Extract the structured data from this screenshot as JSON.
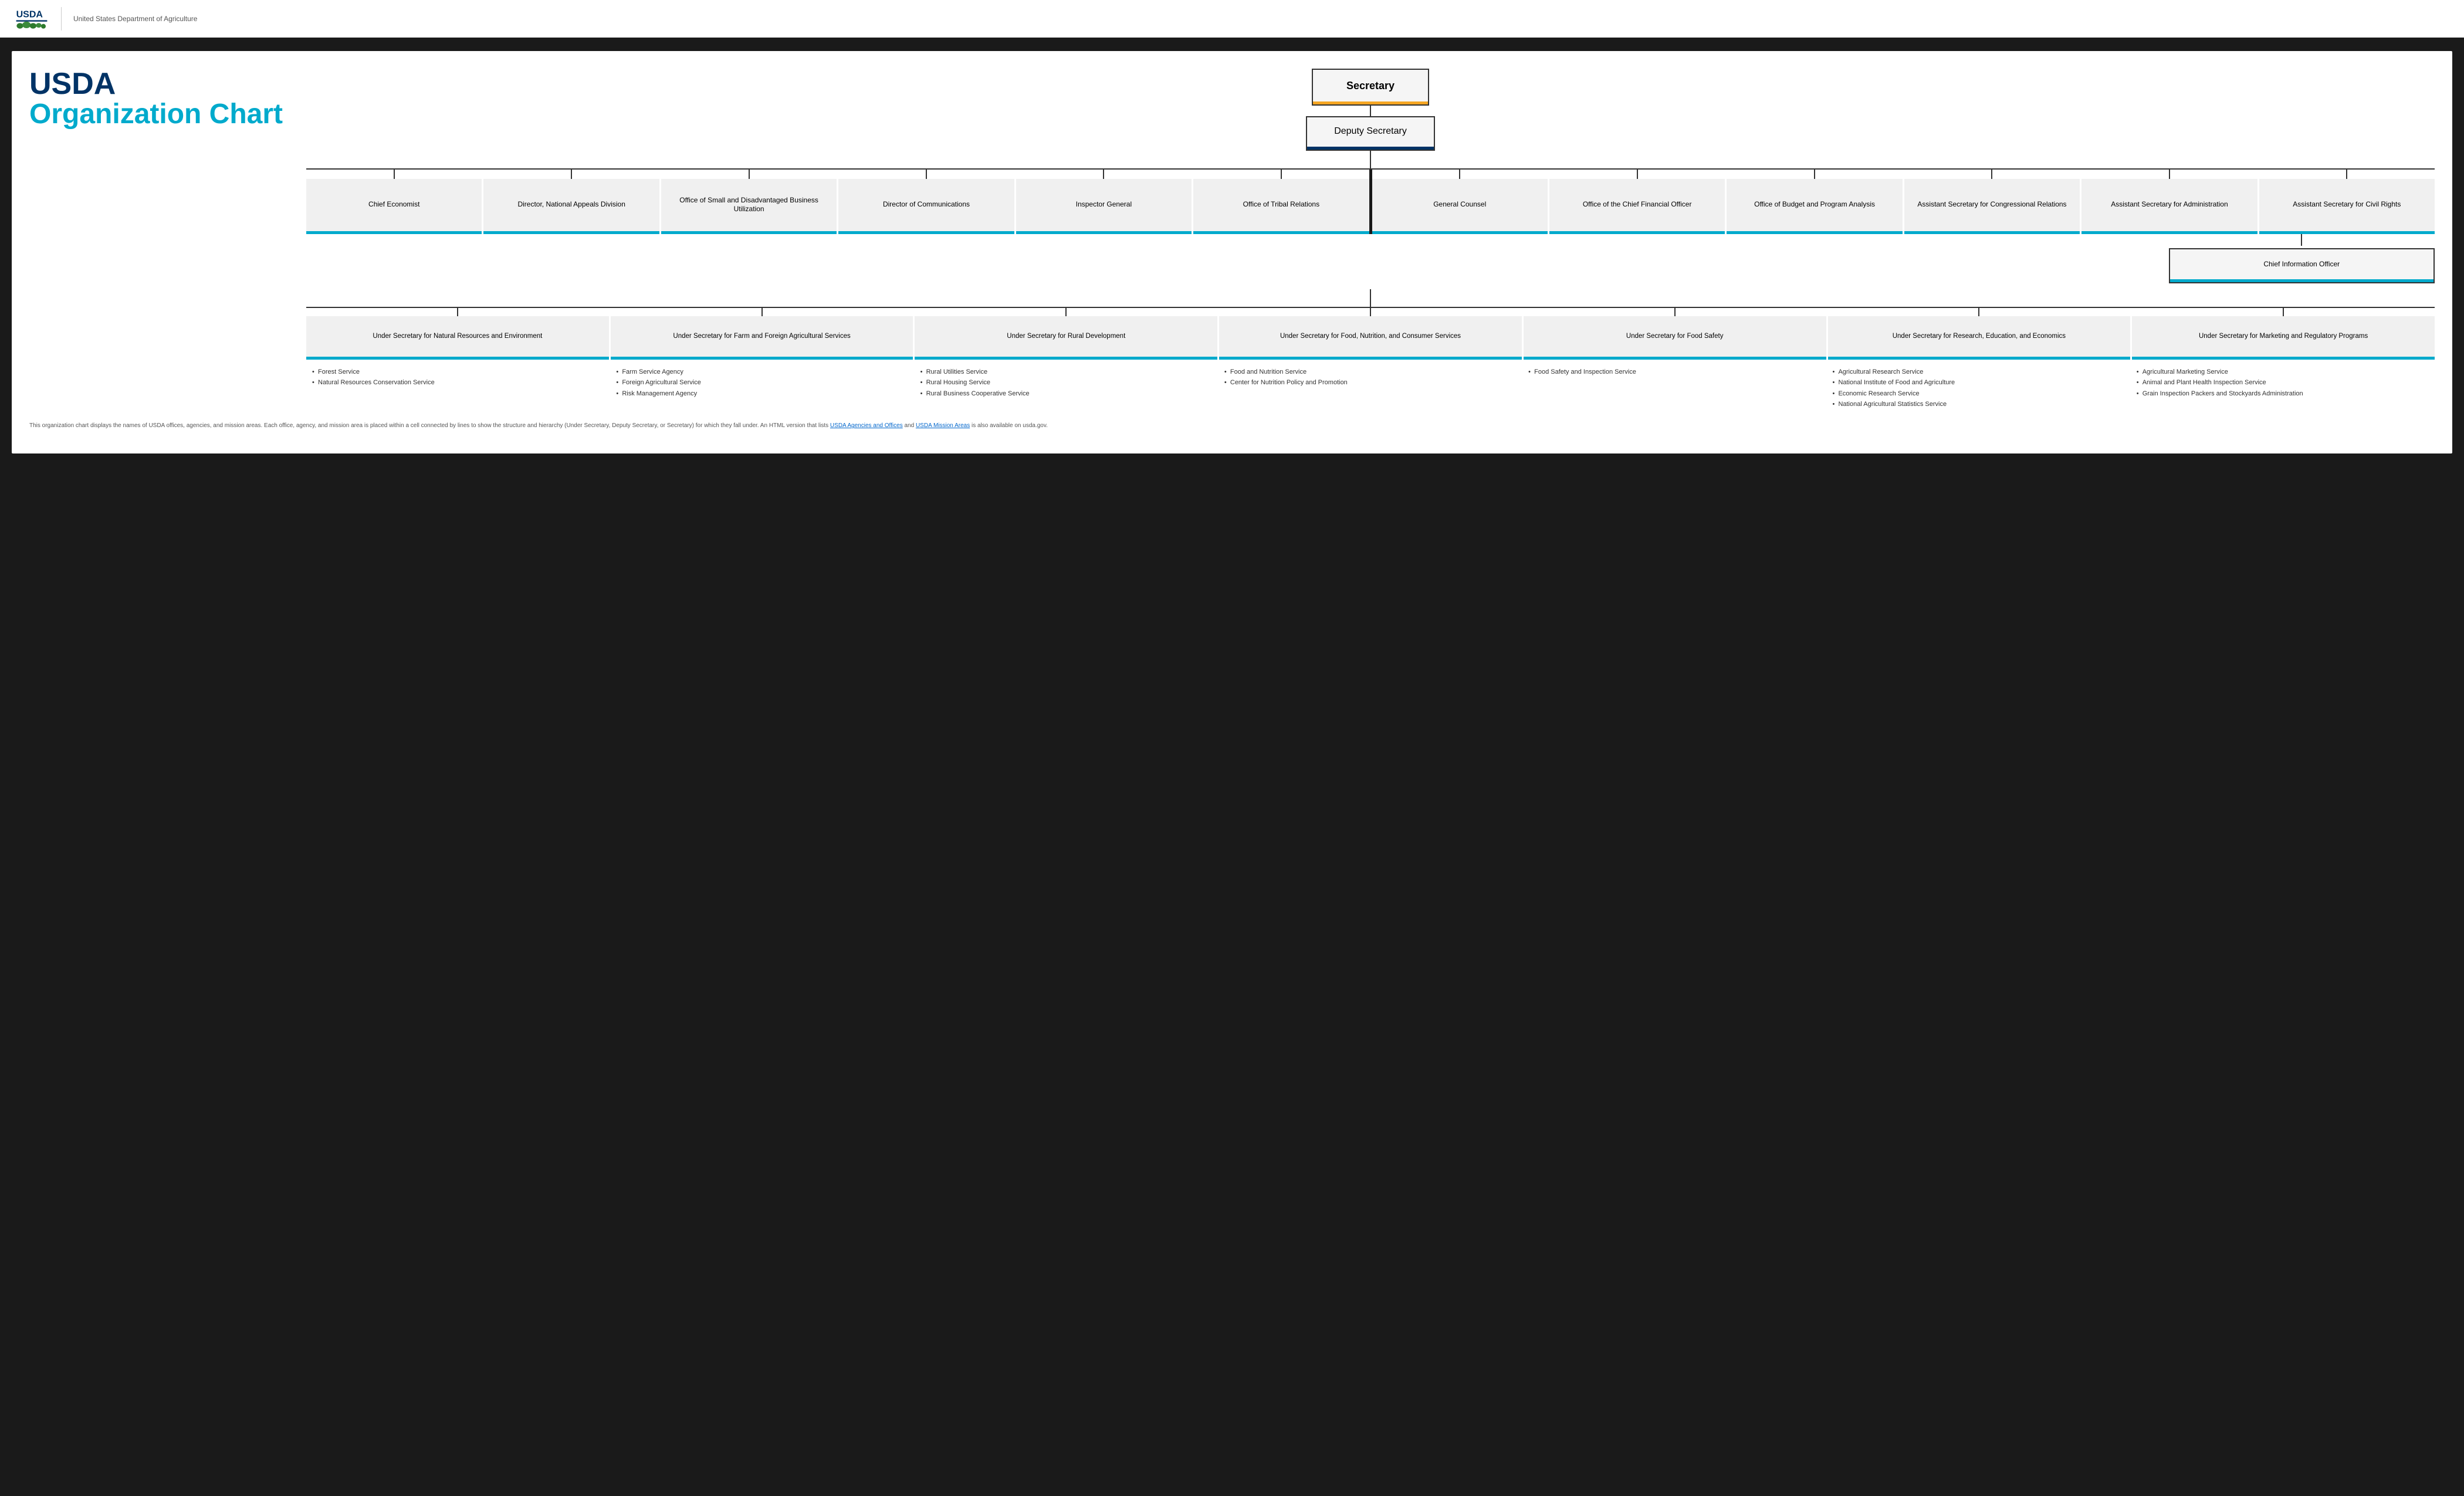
{
  "header": {
    "usda_text": "USDA",
    "subtitle": "United States Department of Agriculture"
  },
  "title": {
    "line1": "USDA",
    "line2": "Organization Chart"
  },
  "org": {
    "secretary": "Secretary",
    "deputy_secretary": "Deputy Secretary",
    "level2_left": [
      {
        "label": "Chief Economist"
      },
      {
        "label": "Director, National Appeals Division"
      },
      {
        "label": "Office of Small and Disadvantaged Business Utilization"
      },
      {
        "label": "Director of Communications"
      },
      {
        "label": "Inspector General"
      },
      {
        "label": "Office of Tribal Relations"
      }
    ],
    "level2_right": [
      {
        "label": "General Counsel"
      },
      {
        "label": "Office of the Chief Financial Officer"
      },
      {
        "label": "Office of Budget and Program Analysis"
      },
      {
        "label": "Assistant Secretary for Congressional Relations"
      },
      {
        "label": "Assistant Secretary for Administration"
      },
      {
        "label": "Assistant Secretary for Civil Rights"
      }
    ],
    "cio": {
      "label": "Chief Information Officer"
    },
    "under_secretaries": [
      {
        "label": "Under Secretary for Natural Resources and Environment"
      },
      {
        "label": "Under Secretary for Farm and Foreign Agricultural Services"
      },
      {
        "label": "Under Secretary for Rural Development"
      },
      {
        "label": "Under Secretary for Food, Nutrition, and Consumer Services"
      },
      {
        "label": "Under Secretary for Food Safety"
      },
      {
        "label": "Under Secretary for Research, Education, and Economics"
      },
      {
        "label": "Under Secretary for Marketing and Regulatory Programs"
      }
    ],
    "bullets": [
      {
        "items": [
          "Forest Service",
          "Natural Resources Conservation Service"
        ]
      },
      {
        "items": [
          "Farm Service Agency",
          "Foreign Agricultural Service",
          "Risk Management Agency"
        ]
      },
      {
        "items": [
          "Rural Utilities Service",
          "Rural Housing Service",
          "Rural Business Cooperative Service"
        ]
      },
      {
        "items": [
          "Food and Nutrition Service",
          "Center for Nutrition Policy and Promotion"
        ]
      },
      {
        "items": [
          "Food Safety and Inspection Service"
        ]
      },
      {
        "items": [
          "Agricultural Research Service",
          "National Institute of Food and Agriculture",
          "Economic Research Service",
          "National Agricultural Statistics Service"
        ]
      },
      {
        "items": [
          "Agricultural Marketing Service",
          "Animal and Plant Health Inspection Service",
          "Grain Inspection Packers and Stockyards Administration"
        ]
      }
    ]
  },
  "footer": {
    "text1": "This organization chart displays the names of USDA offices, agencies, and mission areas. Each office, agency, and mission area is placed within a cell connected by lines to show the structure and hierarchy (Under Secretary, Deputy Secretary, or Secretary) for which they fall under. An HTML version that lists ",
    "link1_text": "USDA Agencies and Offices",
    "link1_href": "#",
    "text2": " and ",
    "link2_text": "USDA Mission Areas",
    "link2_href": "#",
    "text3": " is also available on usda.gov."
  },
  "colors": {
    "dark_bg": "#1a1a1a",
    "brand_blue": "#003366",
    "cyan": "#00aacc",
    "gold": "#f5a623",
    "box_bg": "#f0f0f0",
    "border": "#333333"
  }
}
